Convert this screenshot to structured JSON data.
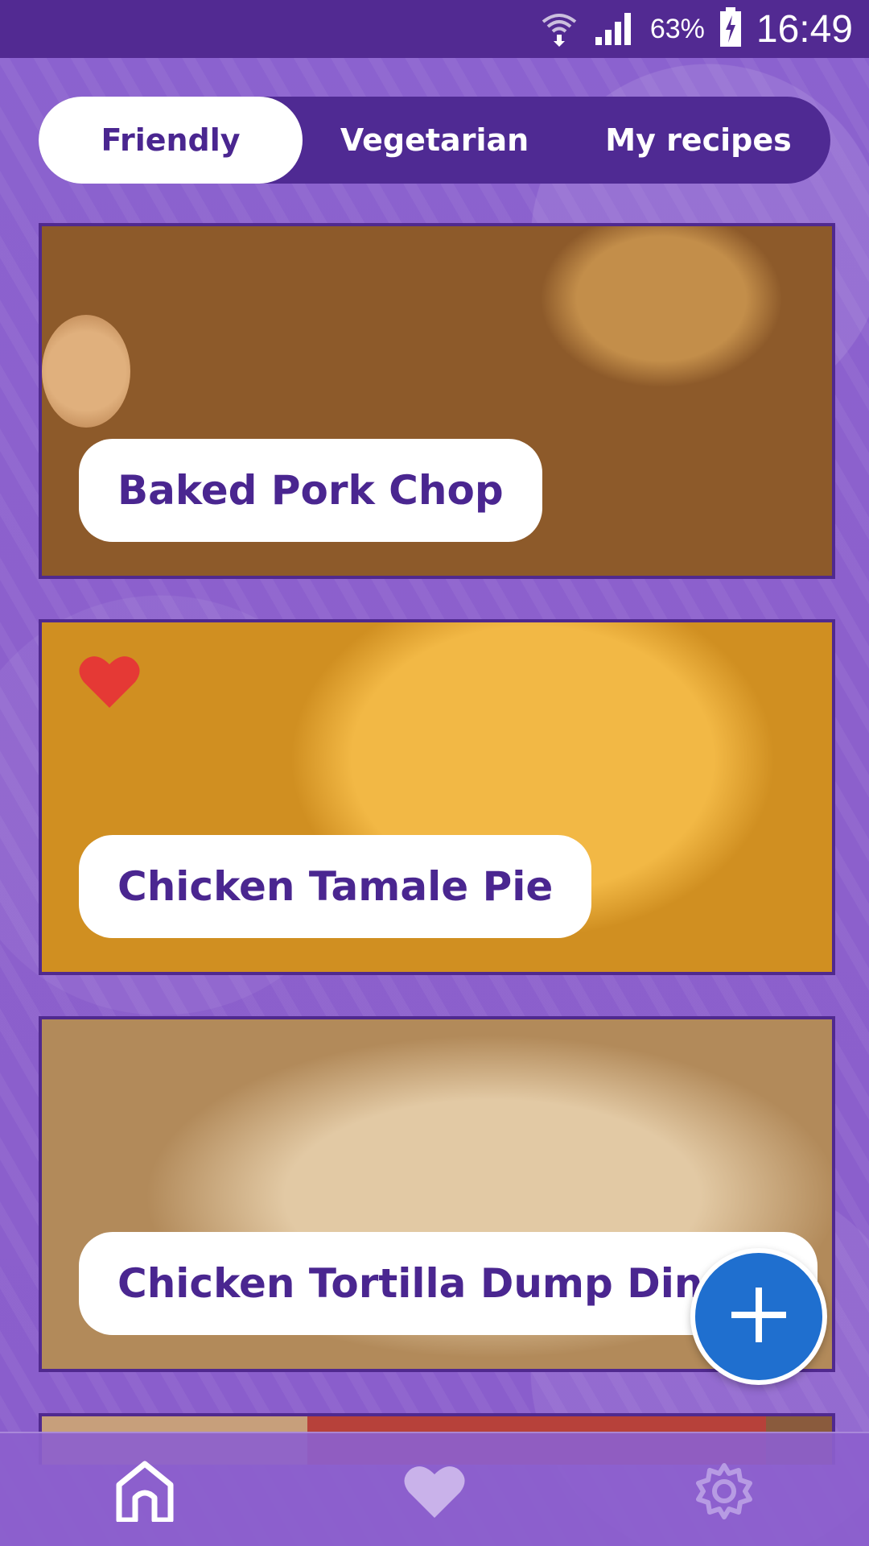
{
  "status_bar": {
    "battery_percent": "63%",
    "time": "16:49",
    "icons": [
      "wifi-icon",
      "signal-icon",
      "battery-charging-icon"
    ]
  },
  "tabs": [
    {
      "label": "Friendly",
      "active": true
    },
    {
      "label": "Vegetarian",
      "active": false
    },
    {
      "label": "My recipes",
      "active": false
    }
  ],
  "recipes": [
    {
      "title": "Baked Pork Chop",
      "favorite": false
    },
    {
      "title": "Chicken Tamale Pie",
      "favorite": true
    },
    {
      "title": "Chicken Tortilla Dump Dinner",
      "favorite": false
    }
  ],
  "fab": {
    "icon": "plus-icon"
  },
  "bottom_nav": [
    {
      "icon": "home-icon",
      "active": true
    },
    {
      "icon": "heart-icon",
      "active": false
    },
    {
      "icon": "gear-icon",
      "active": false
    }
  ],
  "colors": {
    "primary": "#4f2a93",
    "background": "#8a63cc",
    "fab": "#1f6fcf",
    "favorite": "#e53935"
  }
}
